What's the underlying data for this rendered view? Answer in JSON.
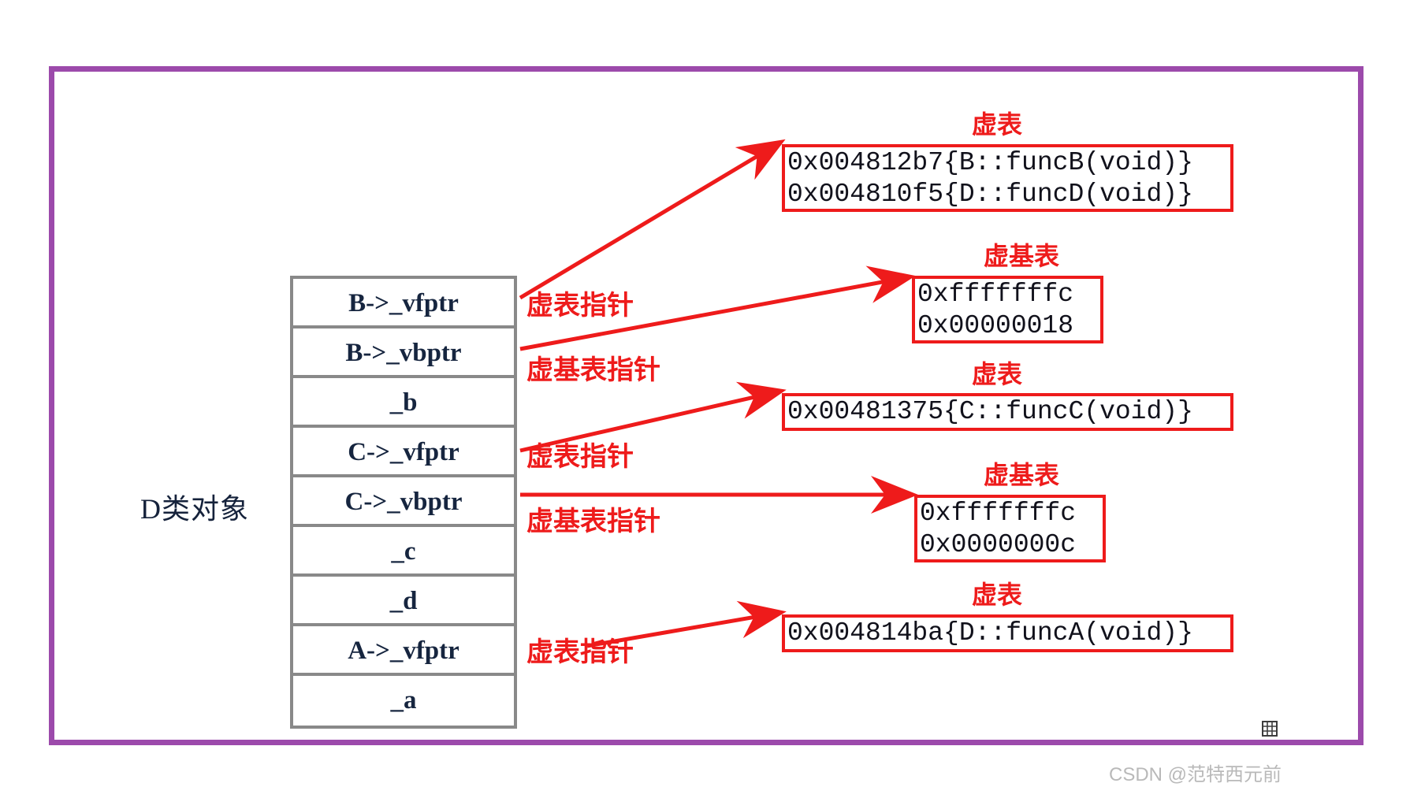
{
  "diagram": {
    "title_label": "D类对象",
    "object_slots": [
      {
        "label": "B->_vfptr"
      },
      {
        "label": "B->_vbptr"
      },
      {
        "label": "_b"
      },
      {
        "label": "C->_vfptr"
      },
      {
        "label": "C->_vbptr"
      },
      {
        "label": "_c"
      },
      {
        "label": "_d"
      },
      {
        "label": "A->_vfptr"
      },
      {
        "label": "_a"
      }
    ],
    "annotations": [
      {
        "text": "虚表指针"
      },
      {
        "text": "虚基表指针"
      },
      {
        "text": "虚表指针"
      },
      {
        "text": "虚基表指针"
      },
      {
        "text": "虚表指针"
      }
    ],
    "tables": [
      {
        "title": "虚表",
        "rows": [
          "0x004812b7{B::funcB(void)}",
          "0x004810f5{D::funcD(void)}"
        ]
      },
      {
        "title": "虚基表",
        "rows": [
          "0xfffffffc",
          "0x00000018"
        ]
      },
      {
        "title": "虚表",
        "rows": [
          "0x00481375{C::funcC(void)}"
        ]
      },
      {
        "title": "虚基表",
        "rows": [
          "0xfffffffc",
          "0x0000000c"
        ]
      },
      {
        "title": "虚表",
        "rows": [
          "0x004814ba{D::funcA(void)}"
        ]
      }
    ],
    "colors": {
      "frame": "#9c4aab",
      "table_border": "#ee1b1b",
      "annotation": "#ee1b1b",
      "slot_border": "#898989",
      "text": "#16253f"
    },
    "icon": "grid-icon",
    "watermark": "CSDN @范特西元前"
  }
}
